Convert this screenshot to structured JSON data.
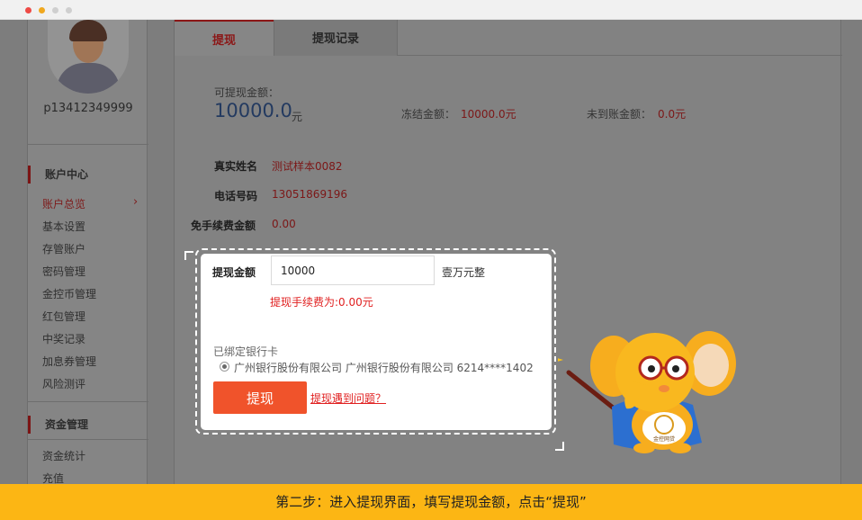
{
  "sidebar": {
    "username": "p13412349999",
    "groups": [
      {
        "title": "账户中心",
        "items": [
          {
            "label": "账户总览",
            "active": true
          },
          {
            "label": "基本设置"
          },
          {
            "label": "存管账户"
          },
          {
            "label": "密码管理"
          },
          {
            "label": "金控币管理"
          },
          {
            "label": "红包管理"
          },
          {
            "label": "中奖记录"
          },
          {
            "label": "加息券管理"
          },
          {
            "label": "风险测评"
          }
        ]
      },
      {
        "title": "资金管理",
        "items": [
          {
            "label": "资金统计"
          },
          {
            "label": "充值"
          }
        ]
      }
    ]
  },
  "tabs": [
    {
      "label": "提现",
      "active": true
    },
    {
      "label": "提现记录"
    }
  ],
  "summary": {
    "available_label": "可提现金额：",
    "available_amount": "10000.0",
    "available_unit": "元",
    "frozen_label": "冻结金额：",
    "frozen_value": "10000.0元",
    "pending_label": "未到账金额：",
    "pending_value": "0.0元"
  },
  "info": {
    "name_label": "真实姓名",
    "name_value": "测试样本0082",
    "phone_label": "电话号码",
    "phone_value": "13051869196",
    "fee_free_label": "免手续费金额",
    "fee_free_value": "0.00"
  },
  "dialog": {
    "amount_label": "提现金额",
    "amount_value": "10000",
    "amount_words": "壹万元整",
    "fee_text": "提现手续费为:0.00元",
    "bound_card_label": "已绑定银行卡",
    "bank_line": "广州银行股份有限公司  广州银行股份有限公司  6214****1402",
    "submit_label": "提现",
    "help_link": "提现遇到问题？"
  },
  "mascot": {
    "badge_text": "金控网贷"
  },
  "banner": {
    "text": "第二步：进入提现界面，填写提现金额，点击“提现”"
  },
  "colors": {
    "accent": "#f0532b",
    "banner": "#fcb614",
    "alert_red": "#e02020"
  }
}
